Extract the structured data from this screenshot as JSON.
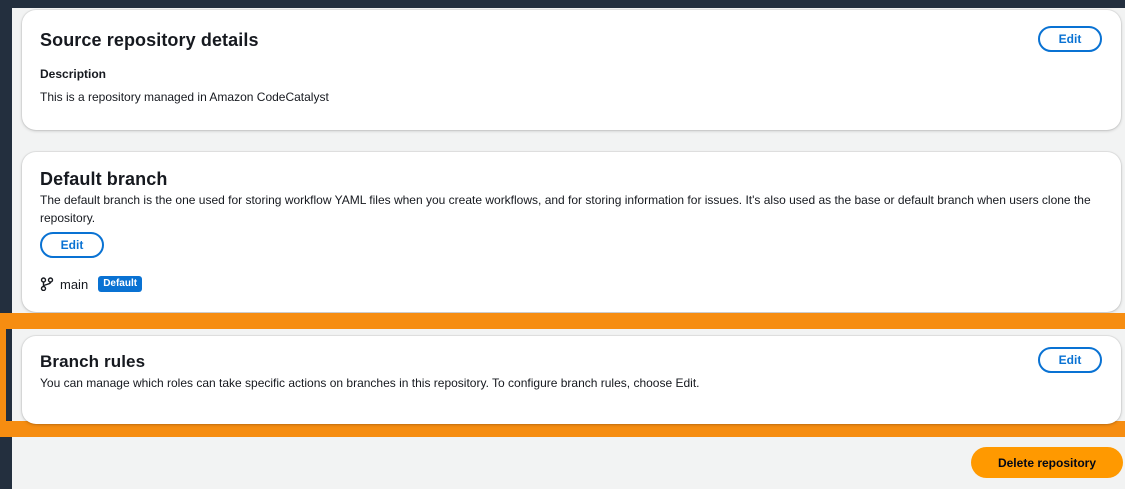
{
  "source_details": {
    "title": "Source repository details",
    "edit_label": "Edit",
    "description_label": "Description",
    "description_text": "This is a repository managed in Amazon CodeCatalyst"
  },
  "default_branch": {
    "title": "Default branch",
    "description": "The default branch is the one used for storing workflow YAML files when you create workflows, and for storing information for issues. It's also used as the base or default branch when users clone the repository.",
    "edit_label": "Edit",
    "branch_name": "main",
    "badge_label": "Default",
    "icon": "git-branch-icon"
  },
  "branch_rules": {
    "title": "Branch rules",
    "description": "You can manage which roles can take specific actions on branches in this repository. To configure branch rules, choose Edit.",
    "edit_label": "Edit"
  },
  "actions": {
    "delete_label": "Delete repository"
  },
  "colors": {
    "accent_blue": "#0972d3",
    "highlight_orange": "#f68d11",
    "delete_button": "#ff9900",
    "dark_frame": "#232f3e"
  }
}
